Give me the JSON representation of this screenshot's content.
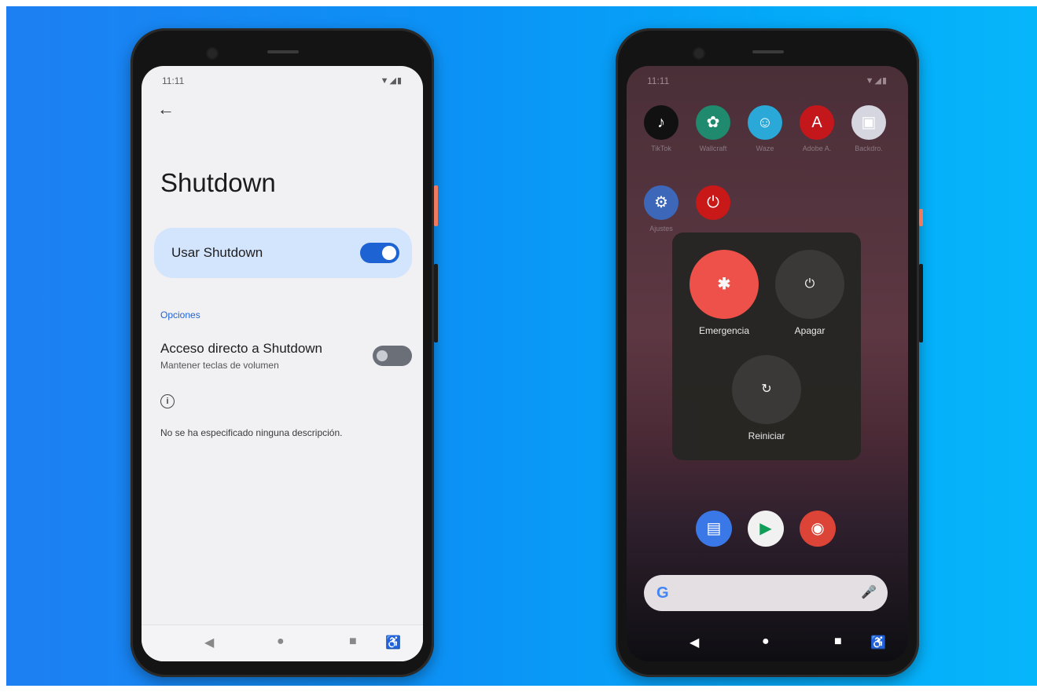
{
  "left_phone": {
    "status": {
      "time": "11:11",
      "icons": "▼◢▮"
    },
    "back_icon": "←",
    "title": "Shutdown",
    "main_toggle": {
      "label": "Usar Shutdown",
      "state": "on"
    },
    "section_header": "Opciones",
    "option": {
      "title": "Acceso directo a Shutdown",
      "subtitle": "Mantener teclas de volumen",
      "state": "off"
    },
    "info_icon": "i",
    "description": "No se ha especificado ninguna descripción.",
    "navbar": {
      "back": "◀",
      "home": "●",
      "recents": "■",
      "accessibility": "♿"
    }
  },
  "right_phone": {
    "status": {
      "time": "11:11",
      "icons": "▼◢▮"
    },
    "apps_row1": [
      {
        "name": "TikTok",
        "label": "TikTok",
        "color": "#111111",
        "glyph": "♪"
      },
      {
        "name": "Wallcraft",
        "label": "Wallcraft",
        "color": "#1f8a6d",
        "glyph": "✿"
      },
      {
        "name": "Waze",
        "label": "Waze",
        "color": "#2aa8d8",
        "glyph": "☺"
      },
      {
        "name": "Adobe Acrobat",
        "label": "Adobe A.",
        "color": "#c4171c",
        "glyph": "A"
      },
      {
        "name": "Backdrops",
        "label": "Backdro.",
        "color": "#d6d6e0",
        "glyph": "▣"
      }
    ],
    "apps_row2": [
      {
        "name": "Settings",
        "label": "Ajustes",
        "color": "#3d67b8",
        "glyph": "⚙"
      },
      {
        "name": "Shutdown",
        "label": "",
        "color": "#c81818",
        "glyph": "⏻"
      }
    ],
    "power_menu": {
      "emergency": {
        "label": "Emergencia",
        "glyph": "✱",
        "color": "#f5534a"
      },
      "power_off": {
        "label": "Apagar",
        "glyph": "⏻"
      },
      "restart": {
        "label": "Reiniciar",
        "glyph": "↻"
      }
    },
    "dock": [
      {
        "name": "Messages",
        "color": "#3b78e7",
        "glyph": "▤"
      },
      {
        "name": "Play Store",
        "color": "#f1f1f1",
        "glyph": "▶"
      },
      {
        "name": "Chrome",
        "color": "#db4437",
        "glyph": "◉"
      }
    ],
    "search_bar": {
      "logo": "G",
      "mic_icon": "🎤"
    },
    "navbar": {
      "back": "◀",
      "home": "●",
      "recents": "■",
      "accessibility": "♿"
    }
  }
}
